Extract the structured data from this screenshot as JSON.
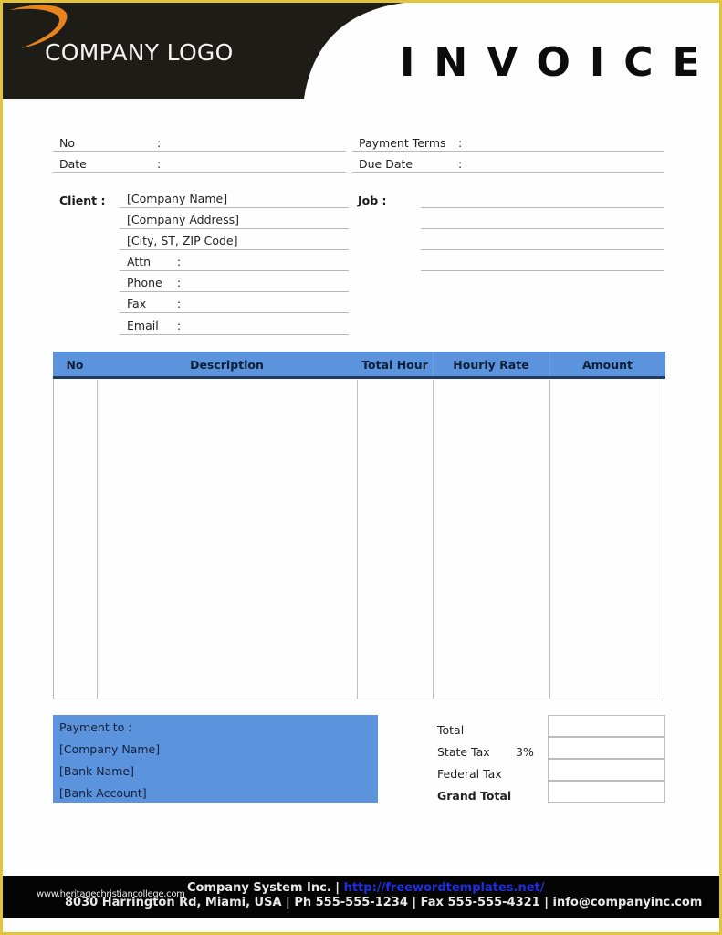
{
  "header": {
    "logo_text": "COMPANY LOGO",
    "title": "INVOICE",
    "band_color": "#1e1c16",
    "swoosh_color": "#e8841e"
  },
  "info": {
    "no_label": "No",
    "date_label": "Date",
    "payment_terms_label": "Payment  Terms",
    "due_date_label": "Due Date",
    "colon": ":"
  },
  "client": {
    "label": "Client  :",
    "company_name": "[Company Name]",
    "company_address": "[Company Address]",
    "city_line": "[City, ST, ZIP Code]",
    "attn_label": "Attn",
    "phone_label": "Phone",
    "fax_label": "Fax",
    "email_label": "Email",
    "colon": ":"
  },
  "job": {
    "label": "Job  :"
  },
  "items_table": {
    "header_color": "#5b93dd",
    "columns": [
      "No",
      "Description",
      "Total Hour",
      "Hourly Rate",
      "Amount"
    ],
    "rows": []
  },
  "payment": {
    "title": "Payment to :",
    "company_name": "[Company Name]",
    "bank_name": "[Bank Name]",
    "bank_account": "[Bank Account]"
  },
  "totals": {
    "total_label": "Total",
    "state_tax_label": "State Tax",
    "state_tax_rate": "3%",
    "federal_tax_label": "Federal Tax",
    "grand_total_label": "Grand Total"
  },
  "footer": {
    "watermark": "www.heritagechristiancollege.com",
    "company": "Company System Inc. |",
    "link": "http://freewordtemplates.net/",
    "address_line": "8030 Harrington Rd, Miami, USA | Ph 555-555-1234 | Fax 555-555-4321 | info@companyinc.com"
  },
  "colors": {
    "page_border": "#e1c43a",
    "accent_blue": "#5b93dd",
    "header_rule": "#1f3864"
  }
}
